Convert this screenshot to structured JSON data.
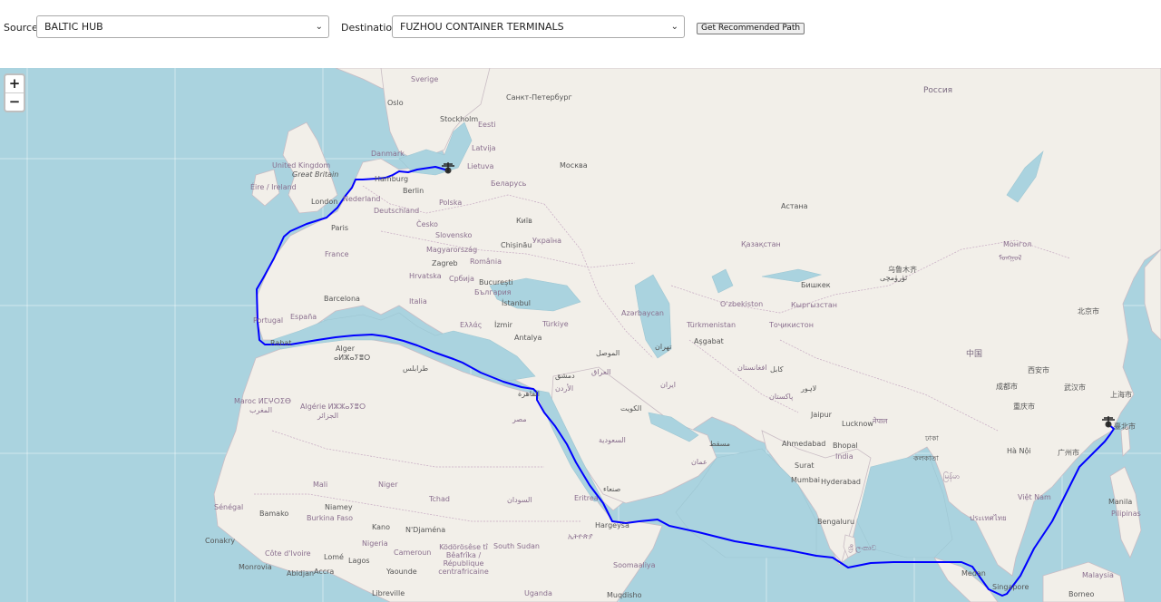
{
  "toolbar": {
    "source_label": "Source:",
    "source_value": "BALTIC HUB",
    "destination_label": "Destination:",
    "destination_value": "FUZHOU CONTAINER TERMINALS",
    "button_label": "Get Recommended Path"
  },
  "map": {
    "zoom_in": "+",
    "zoom_out": "−",
    "route_color": "#0000ff",
    "labels": {
      "sverige": "Sverige",
      "oslo": "Oslo",
      "stockholm": "Stockholm",
      "spb": "Санкт-Петербург",
      "eesti": "Eesti",
      "latvija": "Latvija",
      "lietuva": "Lietuva",
      "danmark": "Danmark",
      "moskva": "Москва",
      "belarus": "Беларусь",
      "rossiya": "Россия",
      "united_kingdom": "United Kingdom",
      "great_britain": "Great Britain",
      "eire": "Éire / Ireland",
      "london": "London",
      "nederland": "Nederland",
      "hamburg": "Hamburg",
      "berlin": "Berlin",
      "polska": "Polska",
      "deutschland": "Deutschland",
      "kyiv": "Київ",
      "ukraina": "Україна",
      "cesko": "Česko",
      "slovensko": "Slovensko",
      "paris": "Paris",
      "chisinau": "Chișinău",
      "france": "France",
      "magyarorszag": "Magyarország",
      "zagreb": "Zagreb",
      "romania": "România",
      "hrvatska": "Hrvatska",
      "srbija": "Србија",
      "bucuresti": "București",
      "bulgaria": "България",
      "italia": "Italia",
      "barcelona": "Barcelona",
      "istanbul": "İstanbul",
      "espana": "España",
      "portugal": "Portugal",
      "ellas": "Ελλάς",
      "izmir": "İzmir",
      "turkiye": "Türkiye",
      "antalya": "Antalya",
      "rabat": "Rabat",
      "alger": "Alger",
      "alger_ar": "ⴰⵍⵣⴰⵢⴻⵔ",
      "maroc": "Maroc ⵍⵎⵖⵔⵉⴱ",
      "maroc_ar": "المغرب",
      "algerie": "Algérie ⵍⵣⵣⴰⵢⴻⵔ",
      "algerie_ar": "الجزائر",
      "tarabulus": "طرابلس",
      "qahira": "القاهرة",
      "misr": "مصر",
      "dimashq": "دمشق",
      "urdun": "الأردن",
      "iraq": "العراق",
      "mosul": "الموصل",
      "kuwait": "الكويت",
      "saudi": "السعودية",
      "qazaqstan": "Қазақстан",
      "astana": "Астана",
      "ozbekiston": "Oʻzbekiston",
      "turkmenistan": "Türkmenistan",
      "ashgabat": "Aşgabat",
      "tojikiston": "Тоҷикистон",
      "kyrgyzstan": "Кыргызстан",
      "bishkek": "Бишкек",
      "azerbaycan": "Azərbaycan",
      "tehran": "تهران",
      "iran": "ایران",
      "afghanistan": "افغانستان",
      "kabul": "کابل",
      "pakistan": "پاکستان",
      "lahore": "لاہور",
      "jaipur": "Jaipur",
      "lucknow": "Lucknow",
      "nepal": "नेपाल",
      "ahmedabad": "Ahmedabad",
      "bhopal": "Bhopal",
      "india": "India",
      "surat": "Surat",
      "mumbai": "Mumbai",
      "hyderabad": "Hyderabad",
      "bengaluru": "Bengaluru",
      "mongol": "Монгол",
      "mongol_script": "ᠮᠣᠩᠭᠣᠯ",
      "urumqi": "乌鲁木齐",
      "urumqi_ug": "ئۈرۈمچى",
      "china": "中国",
      "beijing": "北京市",
      "shanghai": "上海市",
      "chengdu": "成都市",
      "chongqing": "重庆市",
      "wuhan": "武汉市",
      "xian": "西安市",
      "guangzhou": "广州市",
      "taiwan": "臺北市",
      "sanaa": "صنعاء",
      "eritrea": "Eritrea",
      "hargeysa": "Hargeysa",
      "muscat": "مسقط",
      "oman": "عمان",
      "mali": "Mali",
      "niger": "Niger",
      "tchad": "Tchad",
      "sudan": "السودان",
      "niamey": "Niamey",
      "bamako": "Bamako",
      "burkina": "Burkina Faso",
      "senegal": "Sénégal",
      "conakry": "Conakry",
      "cote": "Côte d'Ivoire",
      "monrovia": "Monrovia",
      "abidjan": "Abidjan",
      "accra": "Accra",
      "lome": "Lomé",
      "lagos": "Lagos",
      "nigeria": "Nigeria",
      "kano": "Kano",
      "ndjamena": "N'Djaména",
      "cameroun": "Cameroun",
      "yaounde": "Yaounde",
      "centrafrique": "Ködörösêse tî Bêafrîka / République centrafricaine",
      "south_sudan": "South Sudan",
      "somaliya": "Soomaaliya",
      "uganda": "Uganda",
      "muqdisho": "Muqdisho",
      "libreville": "Libreville",
      "ethiopia": "ኢትዮጵያ",
      "sri_lanka": "ශ්‍රී ලංකාව",
      "medan": "Medan",
      "singapore": "Singapore",
      "thailand": "ประเทศไทย",
      "myanmar": "မြန်မာ",
      "viet_nam": "Việt Nam",
      "malaysia": "Malaysia",
      "pilipinas": "Pilipinas",
      "manila": "Manila",
      "borneo": "Borneo",
      "hanoi": "Hà Nội",
      "kolkata": "কলকাতা",
      "dhaka": "ঢাকা"
    }
  }
}
